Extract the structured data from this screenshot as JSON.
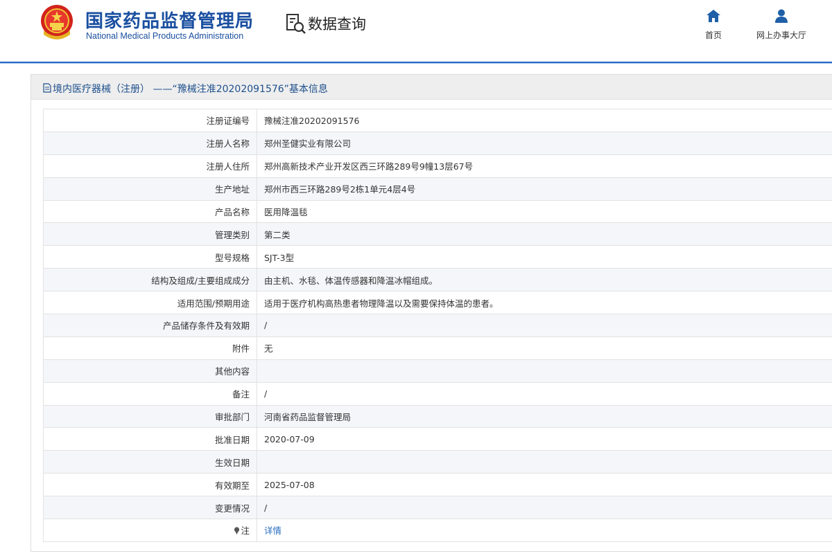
{
  "header": {
    "title_cn": "国家药品监督管理局",
    "title_en": "National Medical Products Administration",
    "query_label": "数据查询",
    "nav": [
      {
        "label": "首页",
        "icon": "home-icon"
      },
      {
        "label": "网上办事大厅",
        "icon": "user-icon"
      }
    ]
  },
  "panel": {
    "title": "境内医疗器械（注册） ——“豫械注准20202091576”基本信息",
    "rows": [
      {
        "label": "注册证编号",
        "value": "豫械注准20202091576"
      },
      {
        "label": "注册人名称",
        "value": "郑州圣健实业有限公司"
      },
      {
        "label": "注册人住所",
        "value": "郑州高新技术产业开发区西三环路289号9幢13层67号"
      },
      {
        "label": "生产地址",
        "value": "郑州市西三环路289号2栋1单元4层4号"
      },
      {
        "label": "产品名称",
        "value": "医用降温毯"
      },
      {
        "label": "管理类别",
        "value": "第二类"
      },
      {
        "label": "型号规格",
        "value": "SJT-3型"
      },
      {
        "label": "结构及组成/主要组成成分",
        "value": "由主机、水毯、体温传感器和降温冰帽组成。"
      },
      {
        "label": "适用范围/预期用途",
        "value": "适用于医疗机构高热患者物理降温以及需要保持体温的患者。"
      },
      {
        "label": "产品储存条件及有效期",
        "value": "/"
      },
      {
        "label": "附件",
        "value": "无"
      },
      {
        "label": "其他内容",
        "value": ""
      },
      {
        "label": "备注",
        "value": "/"
      },
      {
        "label": "审批部门",
        "value": "河南省药品监督管理局"
      },
      {
        "label": "批准日期",
        "value": "2020-07-09"
      },
      {
        "label": "生效日期",
        "value": ""
      },
      {
        "label": "有效期至",
        "value": "2025-07-08"
      },
      {
        "label": "变更情况",
        "value": "/"
      }
    ],
    "note": {
      "label": "注",
      "link": "详情"
    }
  },
  "colors": {
    "brand": "#1a4fa0",
    "link": "#2a6dc2",
    "divider": "#2b6cc4"
  }
}
